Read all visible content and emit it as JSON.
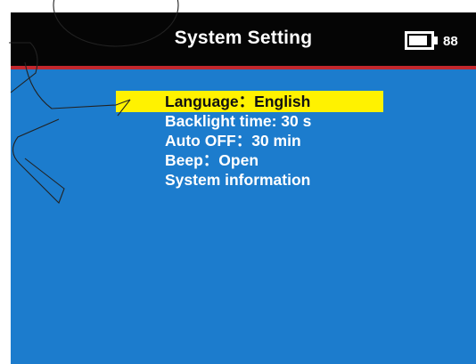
{
  "header": {
    "title": "System Setting",
    "battery_level": 88
  },
  "menu": {
    "items": [
      {
        "label": "Language：English",
        "selected": true
      },
      {
        "label": "Backlight time: 30 s",
        "selected": false
      },
      {
        "label": "Auto OFF：30 min",
        "selected": false
      },
      {
        "label": "Beep：Open",
        "selected": false
      },
      {
        "label": "System information",
        "selected": false
      }
    ]
  },
  "colors": {
    "screen_background": "#1c7ccd",
    "header_background": "#050505",
    "header_divider": "#c1272d",
    "selection_highlight": "#fff200"
  },
  "icons": {
    "battery": "battery-icon",
    "pointer": "pointer-arrow-icon"
  }
}
